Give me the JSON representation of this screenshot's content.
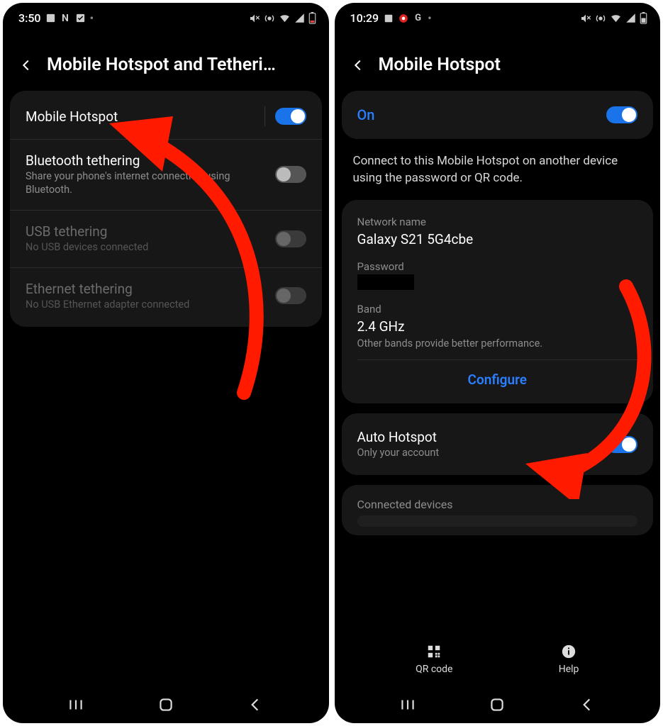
{
  "left": {
    "status": {
      "time": "3:50",
      "icons_left": [
        "image-icon",
        "n-icon",
        "check-icon",
        "dot-icon"
      ]
    },
    "header": {
      "title": "Mobile Hotspot and Tetheri…"
    },
    "rows": [
      {
        "title": "Mobile Hotspot",
        "sub": "",
        "on": true,
        "disabled": false,
        "sep": true
      },
      {
        "title": "Bluetooth tethering",
        "sub": "Share your phone's internet connection using Bluetooth.",
        "on": false,
        "disabled": false
      },
      {
        "title": "USB tethering",
        "sub": "No USB devices connected",
        "on": false,
        "disabled": true
      },
      {
        "title": "Ethernet tethering",
        "sub": "No USB Ethernet adapter connected",
        "on": false,
        "disabled": true
      }
    ]
  },
  "right": {
    "status": {
      "time": "10:29"
    },
    "header": {
      "title": "Mobile Hotspot"
    },
    "on_label": "On",
    "body_text": "Connect to this Mobile Hotspot on another device using the password or QR code.",
    "network": {
      "name_label": "Network name",
      "name_value": "Galaxy S21 5G4cbe",
      "password_label": "Password",
      "band_label": "Band",
      "band_value": "2.4 GHz",
      "band_note": "Other bands provide better performance.",
      "configure": "Configure"
    },
    "auto": {
      "title": "Auto Hotspot",
      "sub": "Only your account"
    },
    "connected_label": "Connected devices",
    "actions": {
      "qr": "QR code",
      "help": "Help"
    }
  }
}
